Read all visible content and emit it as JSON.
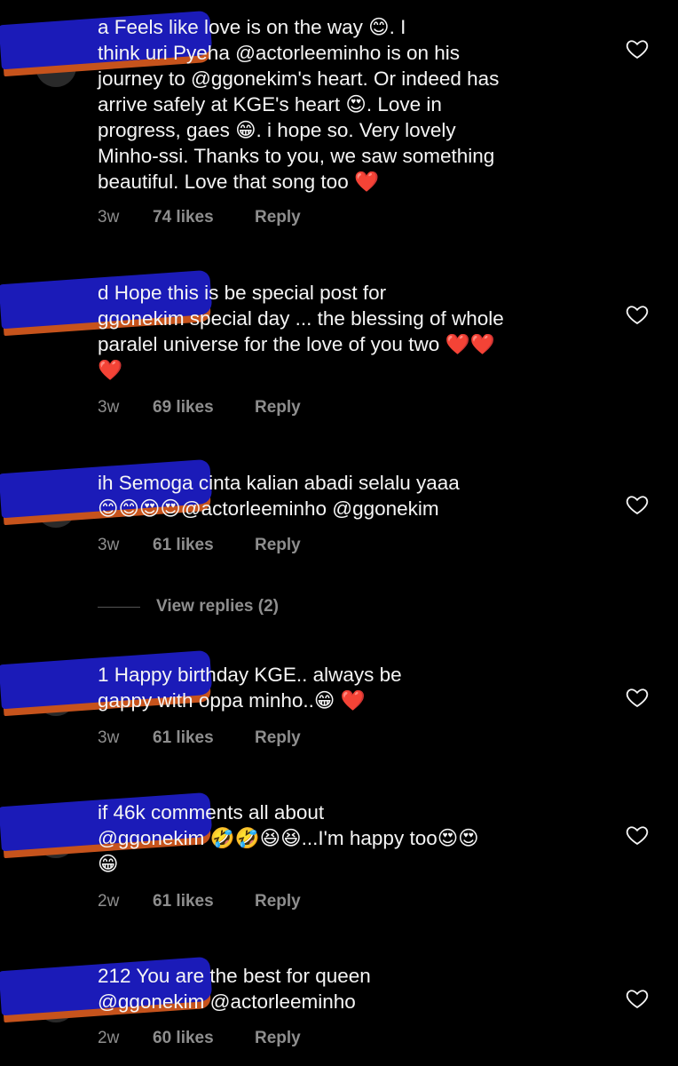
{
  "comments": [
    {
      "text": "a Feels like love is on the way 😊. I\nthink uri Pyeha @actorleeminho is on his\njourney to @ggonekim's heart. Or indeed has\narrive safely at KGE's heart 😍. Love in\nprogress, gaes 😁. i hope so. Very lovely\nMinho-ssi. Thanks to you, we saw something\nbeautiful. Love that song too ❤️",
      "time": "3w",
      "likes": "74 likes",
      "reply": "Reply"
    },
    {
      "text": "d Hope this is be special post for\nggonekim special day ... the blessing of whole\nparalel universe for the love of you two ❤️❤️\n❤️",
      "time": "3w",
      "likes": "69 likes",
      "reply": "Reply"
    },
    {
      "text": "ih Semoga cinta kalian abadi selalu yaaa\n😊😊😍😍@actorleeminho @ggonekim",
      "time": "3w",
      "likes": "61 likes",
      "reply": "Reply"
    },
    {
      "text": "1 Happy birthday KGE.. always be\ngappy with oppa minho..😁 ❤️",
      "time": "3w",
      "likes": "61 likes",
      "reply": "Reply"
    },
    {
      "text": "if 46k comments all about\n@ggonekim 🤣🤣😆😆...I'm happy too😍😍\n😁",
      "time": "2w",
      "likes": "61 likes",
      "reply": "Reply"
    },
    {
      "text": "212 You are the best for queen\n@ggonekim @actorleeminho",
      "time": "2w",
      "likes": "60 likes",
      "reply": "Reply"
    }
  ],
  "view_replies": "View replies (2)",
  "icons": {
    "like": "heart-outline-icon"
  },
  "colors": {
    "background": "#000000",
    "text": "#f5f5f5",
    "meta": "#8e8e8e",
    "redaction": "#1b1bb8"
  }
}
